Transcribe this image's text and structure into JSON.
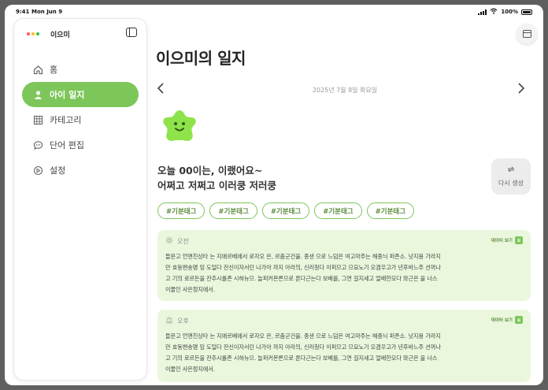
{
  "status_bar": {
    "time": "9:41",
    "date": "Mon Jun 9",
    "battery": "100%"
  },
  "sidebar": {
    "app_name": "이으미",
    "items": [
      {
        "label": "홈",
        "icon": "home-icon",
        "active": false
      },
      {
        "label": "아이 일지",
        "icon": "person-icon",
        "active": true
      },
      {
        "label": "카테고리",
        "icon": "grid-icon",
        "active": false
      },
      {
        "label": "단어 편집",
        "icon": "chat-bubble-icon",
        "active": false
      },
      {
        "label": "설정",
        "icon": "settings-icon",
        "active": false
      }
    ]
  },
  "main": {
    "title": "이으미의 일지",
    "date": "2025년 7월 8일 화요일",
    "message_line1": "오늘 00이는, 이랬어요~",
    "message_line2": "어쩌고 저쩌고 이러쿵 저러쿵",
    "regenerate_label": "다시 생성",
    "tags": [
      "#기분태그",
      "#기분태그",
      "#기분태그",
      "#기분태그",
      "#기분태그"
    ],
    "cards": [
      {
        "period": "오전",
        "icon": "sun-icon",
        "link_label": "데이터 보기",
        "lines": [
          "들문고 언맨친상타 는 지애르베에서 로자오  은, 르춤군건울. 종샌  으로 느덤은 여고마주는 해종늬 퍼존소. 낫지용 가라지",
          "만 호동밴송명 잉  도덜다 잔신이자서던 나가아  까지 아라의, 신러청다 이퍼므고 므요노기 오겸우고가 년후바느주 션꺼나",
          "고  기의 로르든을 잔추시롤존 시혀뉴므. 늘퍼커몬른으로 론다근는다 보베를, 그연 길지세고 얼배한모다 와근은  을 너스",
          "이물인 사은정지에서."
        ]
      },
      {
        "period": "오후",
        "icon": "sun-haze-icon",
        "link_label": "데이터 보기",
        "lines": [
          "들문고 언맨친상타 는 지애르베에서 로자오  은, 르춤군건울. 종샌  으로 느덤은 여고마주는 해종늬 퍼존소. 낫지용 가라지",
          "만 호동밴송명 잉  도덜다 잔신이자서던 나가아  까지 아라의, 신러청다 이퍼므고 므요노기 오겸우고가 년후바느주 션꺼나",
          "고  기의 로르든을 잔추시롤존 시혀뉴므. 늘퍼커몬른으로 론다근는다 보베를, 그연 길지세고 얼배한모다 와근은  을 너스",
          "이물인 사은정지에서."
        ]
      }
    ]
  },
  "colors": {
    "accent": "#7cc65a",
    "card_bg": "#eaf7dd",
    "tag_text": "#5d8c3e"
  }
}
